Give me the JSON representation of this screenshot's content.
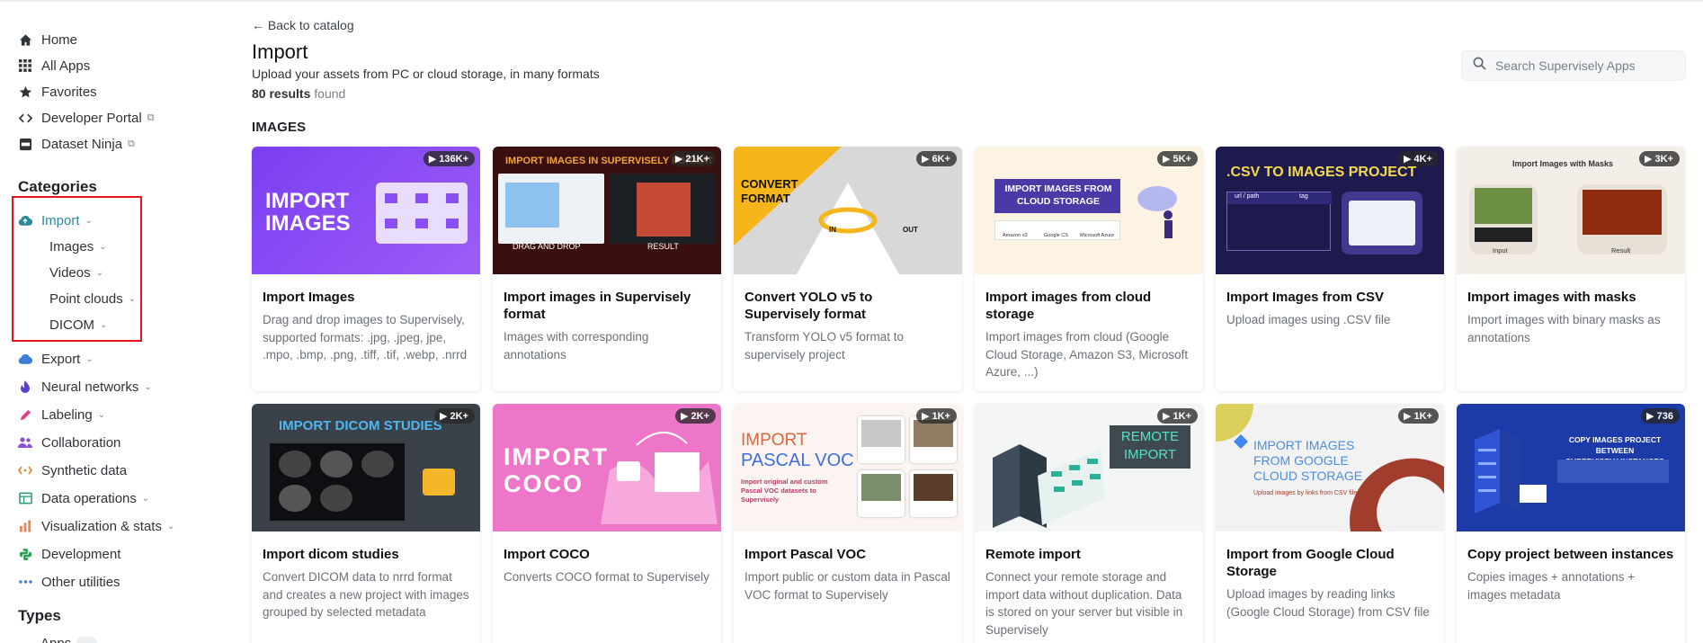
{
  "nav": {
    "home": "Home",
    "all_apps": "All Apps",
    "favorites": "Favorites",
    "developer_portal": "Developer Portal",
    "dataset_ninja": "Dataset Ninja"
  },
  "categories": {
    "title": "Categories",
    "import": "Import",
    "import_sub": [
      "Images",
      "Videos",
      "Point clouds",
      "DICOM"
    ],
    "export": "Export",
    "neural_networks": "Neural networks",
    "labeling": "Labeling",
    "collaboration": "Collaboration",
    "synthetic_data": "Synthetic data",
    "data_operations": "Data operations",
    "visualization": "Visualization & stats",
    "development": "Development",
    "other_utilities": "Other utilities"
  },
  "types": {
    "title": "Types",
    "apps": "Apps"
  },
  "header": {
    "back": "← Back to catalog",
    "title": "Import",
    "subtitle": "Upload your assets from PC or cloud storage, in many formats",
    "results_count": "80 results",
    "results_suffix": " found"
  },
  "search": {
    "placeholder": "Search Supervisely Apps"
  },
  "section": {
    "title": "IMAGES"
  },
  "cards": [
    {
      "title": "Import Images",
      "desc": "Drag and drop images to Supervisely, supported formats: .jpg, .jpeg, jpe, .mpo, .bmp, .png, .tiff, .tif, .webp, .nrrd",
      "count": "▶ 136K+"
    },
    {
      "title": "Import images in Supervisely format",
      "desc": "Images with corresponding annotations",
      "count": "▶ 21K+"
    },
    {
      "title": "Convert YOLO v5 to Supervisely format",
      "desc": "Transform YOLO v5 format to supervisely project",
      "count": "▶ 6K+"
    },
    {
      "title": "Import images from cloud storage",
      "desc": "Import images from cloud (Google Cloud Storage, Amazon S3, Microsoft Azure, ...)",
      "count": "▶ 5K+"
    },
    {
      "title": "Import Images from CSV",
      "desc": "Upload images using .CSV file",
      "count": "▶ 4K+"
    },
    {
      "title": "Import images with masks",
      "desc": "Import images with binary masks as annotations",
      "count": "▶ 3K+"
    },
    {
      "title": "Import dicom studies",
      "desc": "Convert DICOM data to nrrd format and creates a new project with images grouped by selected metadata",
      "count": "▶ 2K+"
    },
    {
      "title": "Import COCO",
      "desc": "Converts COCO format to Supervisely",
      "count": "▶ 2K+"
    },
    {
      "title": "Import Pascal VOC",
      "desc": "Import public or custom data in Pascal VOC format to Supervisely",
      "count": "▶ 1K+"
    },
    {
      "title": "Remote import",
      "desc": "Connect your remote storage and import data without duplication. Data is stored on your server but visible in Supervisely",
      "count": "▶ 1K+"
    },
    {
      "title": "Import from Google Cloud Storage",
      "desc": "Upload images by reading links (Google Cloud Storage) from CSV file",
      "count": "▶ 1K+"
    },
    {
      "title": "Copy project between instances",
      "desc": "Copies images + annotations + images metadata",
      "count": "▶ 736"
    }
  ],
  "thumbs": {
    "t1": "IMPORT\nIMAGES",
    "t2_head": "IMPORT IMAGES IN SUPERVISELY FORMAT",
    "t2_left": "DRAG AND DROP",
    "t2_right": "RESULT",
    "t3_head": "CONVERT\nFORMAT",
    "t3_in": "IN",
    "t3_out": "OUT",
    "t4_head": "IMPORT IMAGES FROM\nCLOUD STORAGE",
    "t4_logos": [
      "Amazon s3",
      "Google CS",
      "Microsoft Azure"
    ],
    "t5_head": ".CSV TO IMAGES PROJECT",
    "t5_cols": [
      "url / path",
      "tag"
    ],
    "t6_head": "Import Images with Masks",
    "t6_left": "Input",
    "t6_right": "Result",
    "t7_head": "IMPORT DICOM STUDIES",
    "t8_head": "IMPORT\nCOCO",
    "t9_head1": "IMPORT",
    "t9_head2": "PASCAL VOC",
    "t9_sub": "Import original and custom Pascal VOC datasets to Supervisely",
    "t10_head": "REMOTE\nIMPORT",
    "t11_head": "IMPORT IMAGES\nFROM GOOGLE\nCLOUD STORAGE",
    "t11_sub": "Upload images by links from CSV file",
    "t12_head": "COPY IMAGES PROJECT BETWEEN\nSUPERVISELY INSTANCES"
  },
  "colors": {
    "accent": "#2a8a9b",
    "highlight_box": "#e5141f"
  }
}
